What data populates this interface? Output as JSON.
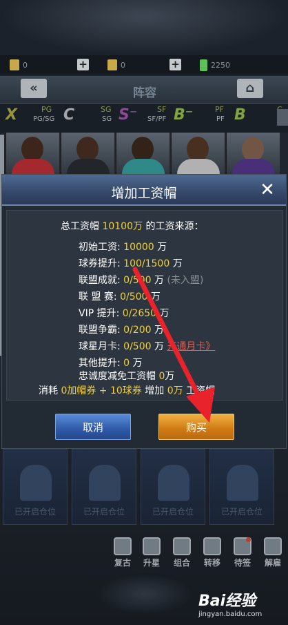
{
  "resources": {
    "ticket1": "0",
    "ticket2": "0",
    "cash": "2250"
  },
  "header": {
    "title": "阵容",
    "back_icon": "double-chevron-left-icon",
    "home_icon": "home-icon"
  },
  "positions": [
    {
      "grade": "X",
      "pos": "PG",
      "sub": "PG/SG",
      "color": "#b7b54a"
    },
    {
      "grade": "C",
      "pos": "SG",
      "sub": "SG",
      "color": "#c7cbd0"
    },
    {
      "grade": "S⁻",
      "pos": "SF",
      "sub": "SF/PF",
      "color": "#b05ab8"
    },
    {
      "grade": "B⁻",
      "pos": "PF",
      "sub": "PF",
      "color": "#9fc94a"
    },
    {
      "grade": "B",
      "pos": "C",
      "sub": "C",
      "color": "#9fc94a"
    }
  ],
  "dialog": {
    "title": "增加工资帽",
    "total_prefix": "总工资帽",
    "total_value": "10100万",
    "total_suffix": "的工资来源：",
    "rows": [
      {
        "label": "初始工资:",
        "value": "10000",
        "unit": "万",
        "extra": ""
      },
      {
        "label": "球券提升:",
        "value": "100/1500",
        "unit": "万",
        "extra": ""
      },
      {
        "label": "联盟成就:",
        "value": "0/500",
        "unit": "万",
        "extra": "(未入盟)"
      },
      {
        "label": "联 盟 赛:",
        "value": "0/500",
        "unit": "万",
        "extra": ""
      },
      {
        "label": "VIP 提升:",
        "value": "0/2650",
        "unit": "万",
        "extra": ""
      },
      {
        "label": "联盟争霸:",
        "value": "0/200",
        "unit": "万",
        "extra": ""
      },
      {
        "label": "球星月卡:",
        "value": "0/500",
        "unit": "万",
        "extra": "开通月卡》"
      },
      {
        "label": "其他提升:",
        "value": "0",
        "unit": "万",
        "extra": ""
      }
    ],
    "loyalty": {
      "label": "忠诚度减免工资帽",
      "value": "0",
      "unit": "万"
    },
    "consume": {
      "prefix": "消耗",
      "cost": "0加帽券 + 10球券",
      "mid": "增加",
      "gain": "0万",
      "suffix": "工资帽"
    },
    "cancel_label": "取消",
    "buy_label": "购买",
    "close_icon": "close-icon"
  },
  "slots": {
    "label": "已开启仓位",
    "count": 4
  },
  "bottom_nav": [
    {
      "label": "复古",
      "icon": "box-icon"
    },
    {
      "label": "升星",
      "icon": "star-icon"
    },
    {
      "label": "组合",
      "icon": "group-icon"
    },
    {
      "label": "转移",
      "icon": "transfer-icon"
    },
    {
      "label": "待签",
      "icon": "contract-icon"
    },
    {
      "label": "解雇",
      "icon": "fire-icon"
    }
  ],
  "watermark": {
    "logo": "Bai经验",
    "url": "jingyan.baidu.com"
  },
  "colors": {
    "accent_yellow": "#f1d03c",
    "link_red": "#e85a4a",
    "arrow_red": "#e8232b"
  }
}
